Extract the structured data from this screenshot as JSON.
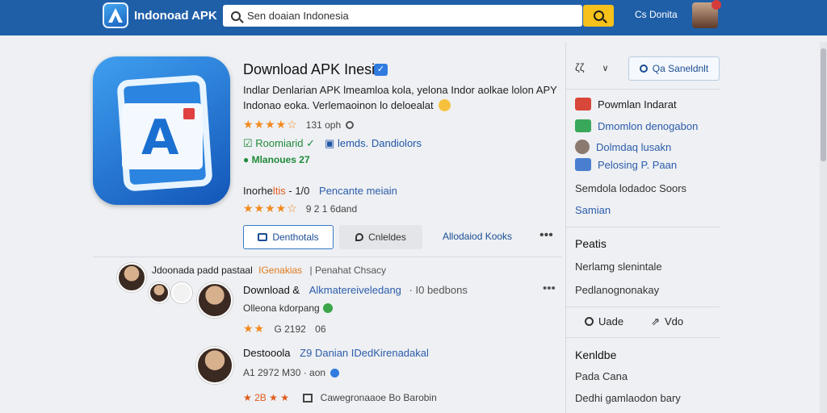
{
  "header": {
    "brand": "Indonoad APK",
    "search_value": "Sen doaian Indonesia",
    "user_name": "Cs Donita"
  },
  "app": {
    "title": "Download APK Inesia",
    "description_line1": "Indlar Denlarian APK lmeamloa kola, yelona Indor aolkae lolon APY",
    "description_line2": "Indonao eoka.  Verlemaoinon lo deloealat",
    "rating_count": "131 oph",
    "link_green": "Roomiarid",
    "link_blue": "lemds. Dandiolors",
    "tag": "Mlanoues",
    "tag_num": "27",
    "installs_prefix": "Inorhe",
    "installs_highlight": "ltis",
    "installs_sep": "- 1/0",
    "installs_blue": "Pencante meiain",
    "rating2_count": "9 2 1 6dand",
    "btn_primary": "Denthotals",
    "btn_secondary": "Cnleldes",
    "btn_link": "Allodaiod Kooks",
    "more": "•••"
  },
  "comments": {
    "head_name": "Jdoonada padd pastaal",
    "head_tag": "IGenakias",
    "head_meta": "| Penahat Chsacy",
    "c1_name": "Download &",
    "c1_link": "Alkmatereiveledang",
    "c1_meta": "· I0 bedbons",
    "c1_sub": "Olleona kdorpang",
    "c1_rate": "G 2192",
    "c1_rate2": "06",
    "c2_name": "Destooola",
    "c2_link": "Z9 Danian IDedKirenadakal",
    "c2_sub": "A1 2972 M30 · aon",
    "c3_prefix": "2B",
    "c3_text": "Cawegronaaoe Bo  Barobin",
    "more": "•••"
  },
  "sidebar": {
    "sort_label": "ζζ",
    "sort_chev": "∨",
    "btn": "Qa Saneldnlt",
    "items": [
      {
        "label": "Powmlan Indarat",
        "color": "#1b1b1b",
        "icon_color": "#d9463a"
      },
      {
        "label": "Dmomlon denogabon",
        "color": "#2c5cab",
        "icon_color": "#3aa85a"
      },
      {
        "label": "Dolmdaq lusakn",
        "color": "#2c5cab",
        "icon_color": "#8a7a70"
      },
      {
        "label": "Pelosing P. Paan",
        "color": "#2c5cab",
        "icon_color": "#4a7fd0"
      }
    ],
    "plain1": "Semdola lodadoc Soors",
    "link1": "Samian",
    "head1": "Peatis",
    "p1": "Nerlamg slenintale",
    "p2": "Pedlanognonakay",
    "action1": "Uade",
    "action2": "Vdo",
    "head2": "Kenldbe",
    "p3": "Pada Cana",
    "p4": "Dedhi gamlaodon bary"
  }
}
